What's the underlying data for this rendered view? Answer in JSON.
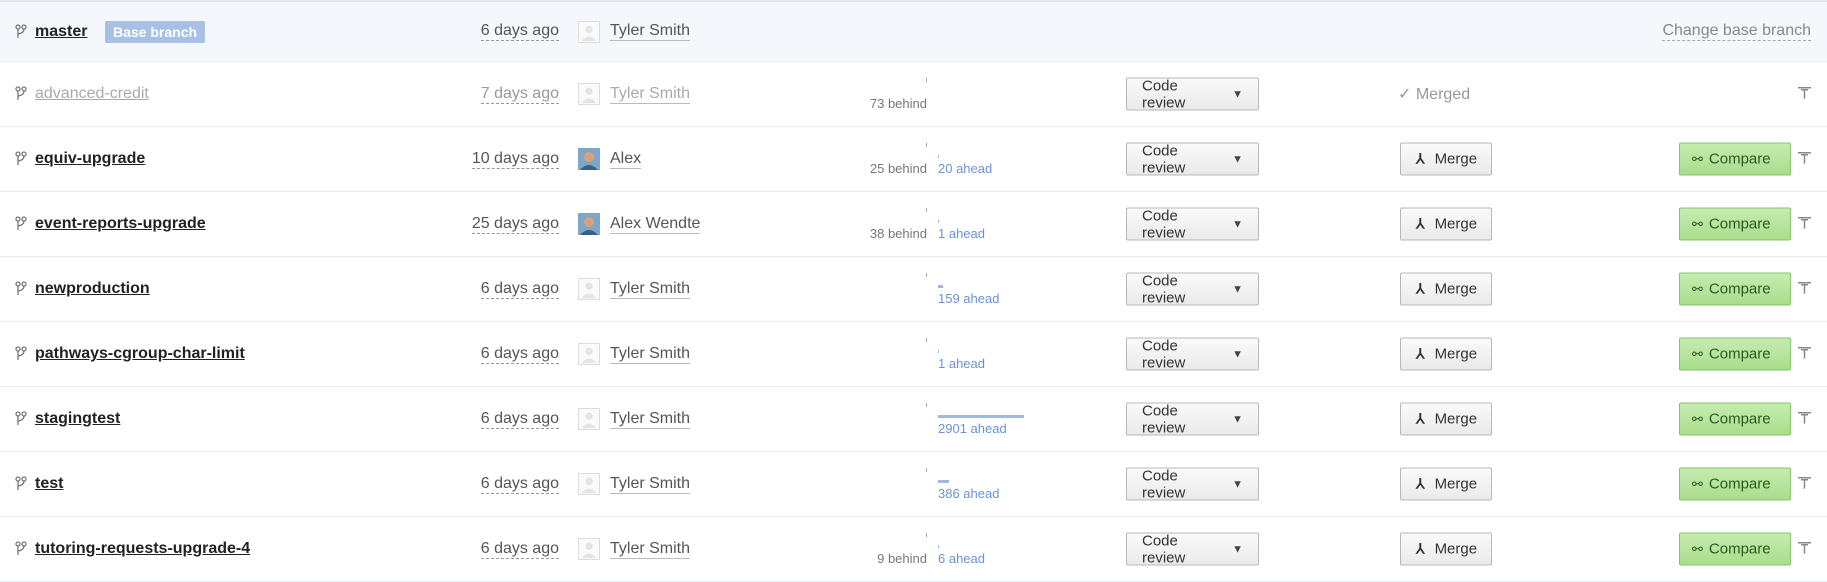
{
  "base": {
    "name": "master",
    "badge": "Base branch",
    "time": "6 days ago",
    "author": "Tyler Smith",
    "change_label": "Change base branch"
  },
  "colors": {
    "ahead": "#6a93d6",
    "compare_green": "#a9dd8d",
    "badge_blue": "#a9c0e6"
  },
  "icons": {
    "branch": "branch-icon",
    "merge": "merge-icon",
    "compare": "compare-icon",
    "pin": "pin-icon",
    "caret": "chevron-down-icon"
  },
  "branches": [
    {
      "name": "advanced-credit",
      "time": "7 days ago",
      "author": "Tyler Smith",
      "avatar": "default",
      "behind": "73 behind",
      "ahead": "",
      "ahead_bar_fraction": 0,
      "review_label": "Code review",
      "merged": true,
      "merged_label": "✓ Merged"
    },
    {
      "name": "equiv-upgrade",
      "time": "10 days ago",
      "author": "Alex",
      "avatar": "photo",
      "behind": "25 behind",
      "ahead": "20 ahead",
      "ahead_bar_fraction": 0.007,
      "review_label": "Code review",
      "merge_label": "Merge",
      "compare_label": "Compare"
    },
    {
      "name": "event-reports-upgrade",
      "time": "25 days ago",
      "author": "Alex Wendte",
      "avatar": "photo",
      "behind": "38 behind",
      "ahead": "1 ahead",
      "ahead_bar_fraction": 0.001,
      "review_label": "Code review",
      "merge_label": "Merge",
      "compare_label": "Compare"
    },
    {
      "name": "newproduction",
      "time": "6 days ago",
      "author": "Tyler Smith",
      "avatar": "default",
      "behind": "",
      "ahead": "159 ahead",
      "ahead_bar_fraction": 0.055,
      "review_label": "Code review",
      "merge_label": "Merge",
      "compare_label": "Compare"
    },
    {
      "name": "pathways-cgroup-char-limit",
      "time": "6 days ago",
      "author": "Tyler Smith",
      "avatar": "default",
      "behind": "",
      "ahead": "1 ahead",
      "ahead_bar_fraction": 0.001,
      "review_label": "Code review",
      "merge_label": "Merge",
      "compare_label": "Compare"
    },
    {
      "name": "stagingtest",
      "time": "6 days ago",
      "author": "Tyler Smith",
      "avatar": "default",
      "behind": "",
      "ahead": "2901 ahead",
      "ahead_bar_fraction": 1,
      "review_label": "Code review",
      "merge_label": "Merge",
      "compare_label": "Compare"
    },
    {
      "name": "test",
      "time": "6 days ago",
      "author": "Tyler Smith",
      "avatar": "default",
      "behind": "",
      "ahead": "386 ahead",
      "ahead_bar_fraction": 0.133,
      "review_label": "Code review",
      "merge_label": "Merge",
      "compare_label": "Compare"
    },
    {
      "name": "tutoring-requests-upgrade-4",
      "time": "6 days ago",
      "author": "Tyler Smith",
      "avatar": "default",
      "behind": "9 behind",
      "ahead": "6 ahead",
      "ahead_bar_fraction": 0.002,
      "review_label": "Code review",
      "merge_label": "Merge",
      "compare_label": "Compare"
    }
  ]
}
